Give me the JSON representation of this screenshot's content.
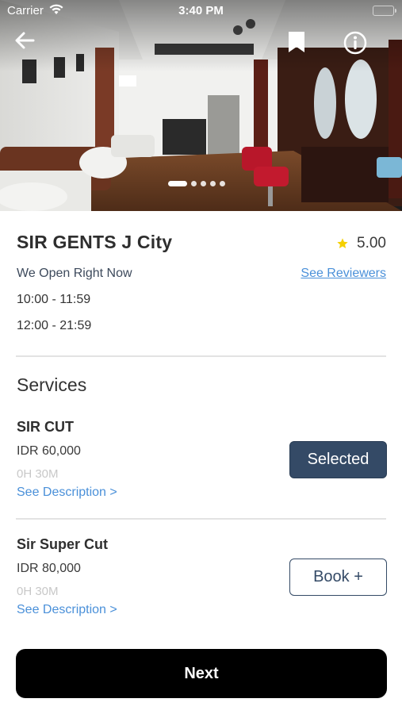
{
  "status_bar": {
    "carrier": "Carrier",
    "time": "3:40 PM"
  },
  "hero": {
    "photo_count": 5,
    "active_index": 0,
    "icons": {
      "back": "arrow-left-icon",
      "bookmark": "bookmark-icon",
      "info": "info-icon"
    }
  },
  "shop": {
    "name": "SIR GENTS J City",
    "rating": "5.00",
    "open_status": "We Open Right Now",
    "see_reviewers_label": "See Reviewers",
    "hours": [
      "10:00 - 11:59",
      "12:00 - 21:59"
    ]
  },
  "services": {
    "title": "Services",
    "items": [
      {
        "name": "SIR CUT",
        "price": "IDR 60,000",
        "duration": "0H 30M",
        "description_link": "See Description >",
        "button_label": "Selected",
        "selected": true
      },
      {
        "name": "Sir Super Cut",
        "price": "IDR 80,000",
        "duration": "0H 30M",
        "description_link": "See Description >",
        "button_label": "Book +",
        "selected": false
      }
    ]
  },
  "footer": {
    "next_label": "Next"
  },
  "colors": {
    "accent_navy": "#344a66",
    "link_blue": "#4a90d9",
    "star_yellow": "#f5d000",
    "primary_button": "#000000"
  }
}
